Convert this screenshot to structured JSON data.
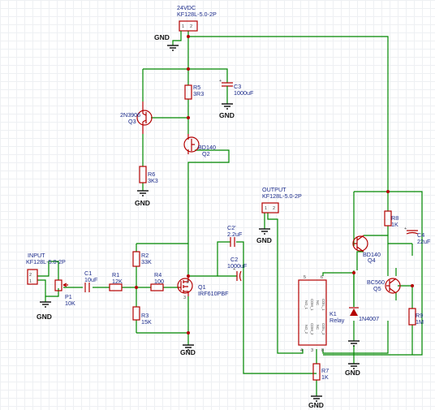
{
  "components": {
    "gnd_label": "GND",
    "power_connector": {
      "label": "24VDC",
      "part": "KF128L-5.0-2P"
    },
    "input_connector": {
      "label": "INPUT",
      "part": "KF128L-5.0-2P"
    },
    "output_connector": {
      "label": "OUTPUT",
      "part": "KF128L-5.0-2P"
    },
    "r5": {
      "ref": "R5",
      "value": "3R3"
    },
    "c3": {
      "ref": "C3",
      "value": "1000uF"
    },
    "q3": {
      "ref": "2N3906",
      "value": "Q3"
    },
    "q2": {
      "ref": "BD140",
      "value": "Q2"
    },
    "r6": {
      "ref": "R6",
      "value": "3K3"
    },
    "p1": {
      "ref": "P1",
      "value": "10K"
    },
    "c1": {
      "ref": "C1",
      "value": "10uF"
    },
    "r1": {
      "ref": "R1",
      "value": "12K"
    },
    "r2": {
      "ref": "R2",
      "value": "33K"
    },
    "r3": {
      "ref": "R3",
      "value": "15K"
    },
    "r4": {
      "ref": "R4",
      "value": "100"
    },
    "q1": {
      "ref": "Q1",
      "value": "IRF610PBF"
    },
    "c2_prime": {
      "ref": "C2'",
      "value": "2.2uF"
    },
    "c2": {
      "ref": "C2",
      "value": "1000uF"
    },
    "k1": {
      "ref": "K1",
      "value": "Relay"
    },
    "r7": {
      "ref": "R7",
      "value": "1K"
    },
    "d1": {
      "value": "1N4007"
    },
    "r8": {
      "ref": "R8",
      "value": "1K"
    },
    "c4": {
      "ref": "C4",
      "value": "22uF"
    },
    "q4": {
      "ref": "BD140",
      "value": "Q4"
    },
    "q5": {
      "ref": "BC560",
      "value": "Q5"
    },
    "r9": {
      "ref": "R9",
      "value": "1M"
    }
  }
}
